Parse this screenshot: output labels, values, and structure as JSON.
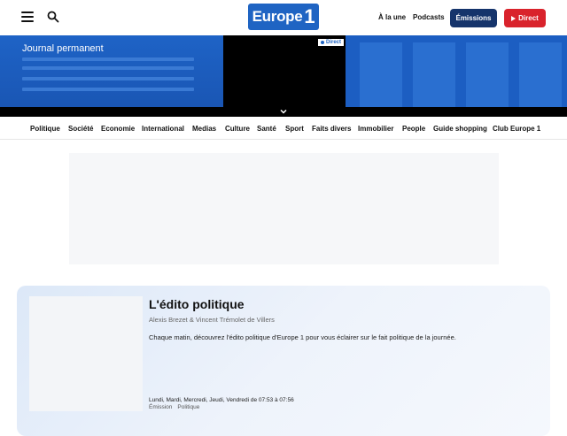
{
  "header": {
    "logo_text": "Europe",
    "logo_number": "1",
    "nav": [
      "À la une",
      "Podcasts"
    ],
    "emissions_label": "Émissions",
    "direct_label": "Direct"
  },
  "live": {
    "title": "Journal permanent",
    "badge": "Direct"
  },
  "categories": [
    "Politique",
    "Société",
    "Economie",
    "International",
    "Medias",
    "Culture",
    "Santé",
    "Sport",
    "Faits divers",
    "Immobilier",
    "People",
    "Guide shopping",
    "Club Europe 1"
  ],
  "emission": {
    "title": "L'édito politique",
    "authors": "Alexis Brezet & Vincent Trémolet de Villers",
    "description": "Chaque matin, découvrez l'édito politique d'Europe 1 pour vous éclairer sur le fait politique de la journée.",
    "schedule": "Lundi, Mardi, Mercredi, Jeudi, Vendredi de 07:53 à 07:56",
    "tags": [
      "Émission",
      "Politique"
    ]
  },
  "colors": {
    "brand_blue": "#1f64c3",
    "navy": "#15346b",
    "red": "#d9232c"
  }
}
